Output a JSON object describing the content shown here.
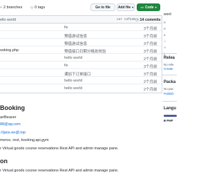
{
  "toolbar": {
    "branches_label": "2 branches",
    "tags_label": "0 tags",
    "go_to_file": "Go to file",
    "add_file": "Add file",
    "code": "Code"
  },
  "file_table": {
    "latest_commit_title": "ello world",
    "commit_hash": "ser c3f240",
    "commits_count": "14 commits",
    "rows": [
      {
        "name": "",
        "message": "fix",
        "age": "3个月前"
      },
      {
        "name": "",
        "message": "预借游试信息",
        "age": "3个月前"
      },
      {
        "name": "",
        "message": "预借游试信息",
        "age": "3个月前"
      },
      {
        "name": "ooking.php",
        "message": "预借接口日期分格处校验",
        "age": "3个月前"
      },
      {
        "name": "",
        "message": "hello world",
        "age": "2个月前"
      },
      {
        "name": "",
        "message": "fix",
        "age": "3个月前"
      },
      {
        "name": "",
        "message": "课加下订单接口",
        "age": "3个月前"
      },
      {
        "name": "",
        "message": "hello world",
        "age": "2个月前"
      },
      {
        "name": "",
        "message": "hello world",
        "age": "2个月前"
      }
    ]
  },
  "readme": {
    "title": "Booking",
    "author": "ariBeaver",
    "email": "88@qq.com",
    "site": "://jaos.ee@.top",
    "tags": "merce, rest, booking,api,gym",
    "desc1": "r Virtual goods course reservations Rest API and admin manage pane.",
    "desc2": "r Virtual goods course reservations Rest API and admin manage pane.",
    "section2": "on"
  },
  "sidebar": {
    "about": "word",
    "about_items": [
      "R",
      "R",
      "A",
      "☆",
      "☉",
      "ȳ"
    ],
    "releases_h": "Relea",
    "releases_t": "No rele",
    "releases_link": "Create",
    "packages_h": "Packa",
    "packages_t": "No pac",
    "packages_link": "Publish",
    "languages_h": "Langu",
    "languages_item": "PHP"
  },
  "colors": {
    "code_button": "#1f883d",
    "link": "#0969da",
    "php": "#4F5D95"
  }
}
